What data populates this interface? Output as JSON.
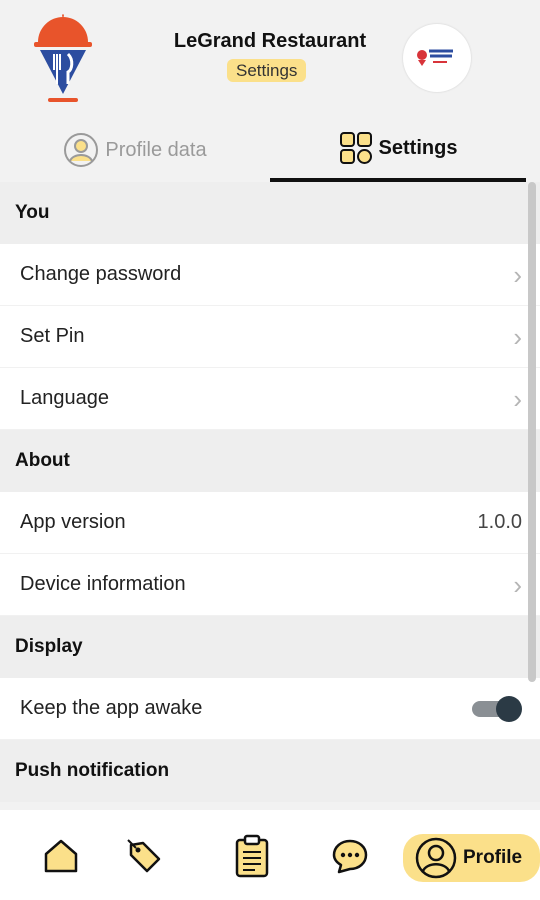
{
  "header": {
    "restaurant_name": "LeGrand Restaurant",
    "screen_label": "Settings"
  },
  "tabs": [
    {
      "label": "Profile data",
      "icon": "person-circle-icon",
      "active": false
    },
    {
      "label": "Settings",
      "icon": "grid-icon",
      "active": true
    }
  ],
  "sections": {
    "you": {
      "title": "You",
      "items": [
        {
          "label": "Change password"
        },
        {
          "label": "Set Pin"
        },
        {
          "label": "Language"
        }
      ]
    },
    "about": {
      "title": "About",
      "items": [
        {
          "label": "App version",
          "value": "1.0.0"
        },
        {
          "label": "Device information"
        }
      ]
    },
    "display": {
      "title": "Display",
      "items": [
        {
          "label": "Keep the app awake",
          "toggle": true
        }
      ]
    },
    "push": {
      "title": "Push notification"
    }
  },
  "bottom_nav": {
    "items": [
      "home-icon",
      "tag-icon",
      "clipboard-icon",
      "chat-icon"
    ],
    "profile_label": "Profile"
  },
  "colors": {
    "accent": "#fbe08a",
    "toggle_knob": "#2b3a45"
  }
}
